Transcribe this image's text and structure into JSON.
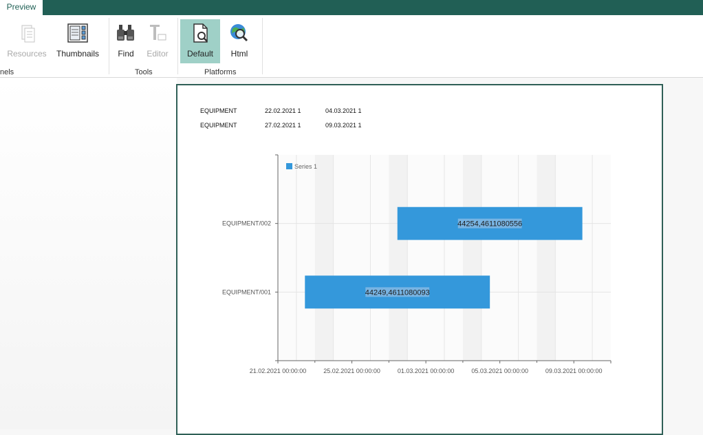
{
  "ribbon": {
    "tab_label": "Preview",
    "buttons": {
      "resources": "Resources",
      "thumbnails": "Thumbnails",
      "find": "Find",
      "editor": "Editor",
      "default": "Default",
      "html": "Html"
    },
    "groups": {
      "panels": "nels",
      "tools": "Tools",
      "platforms": "Platforms"
    }
  },
  "report": {
    "rows": [
      [
        "EQUIPMENT",
        "22.02.2021 1",
        "04.03.2021 1"
      ],
      [
        "EQUIPMENT",
        "27.02.2021 1",
        "09.03.2021 1"
      ]
    ]
  },
  "chart_data": {
    "type": "bar",
    "orientation": "horizontal-range",
    "categories": [
      "EQUIPMENT/002",
      "EQUIPMENT/001"
    ],
    "series": [
      {
        "name": "Series 1",
        "color": "#3498db",
        "ranges": [
          {
            "category": "EQUIPMENT/002",
            "start": "2021-02-27",
            "end": "2021-03-09",
            "label": "44254,4611080556"
          },
          {
            "category": "EQUIPMENT/001",
            "start": "2021-02-22",
            "end": "2021-03-04",
            "label": "44249,4611080093"
          }
        ]
      }
    ],
    "x_ticks": [
      "21.02.2021 00:00:00",
      "25.02.2021 00:00:00",
      "01.03.2021 00:00:00",
      "05.03.2021 00:00:00",
      "09.03.2021 00:00:00"
    ],
    "xlim": [
      "2021-02-21",
      "2021-03-11"
    ],
    "legend": "top-left",
    "grid": true
  }
}
